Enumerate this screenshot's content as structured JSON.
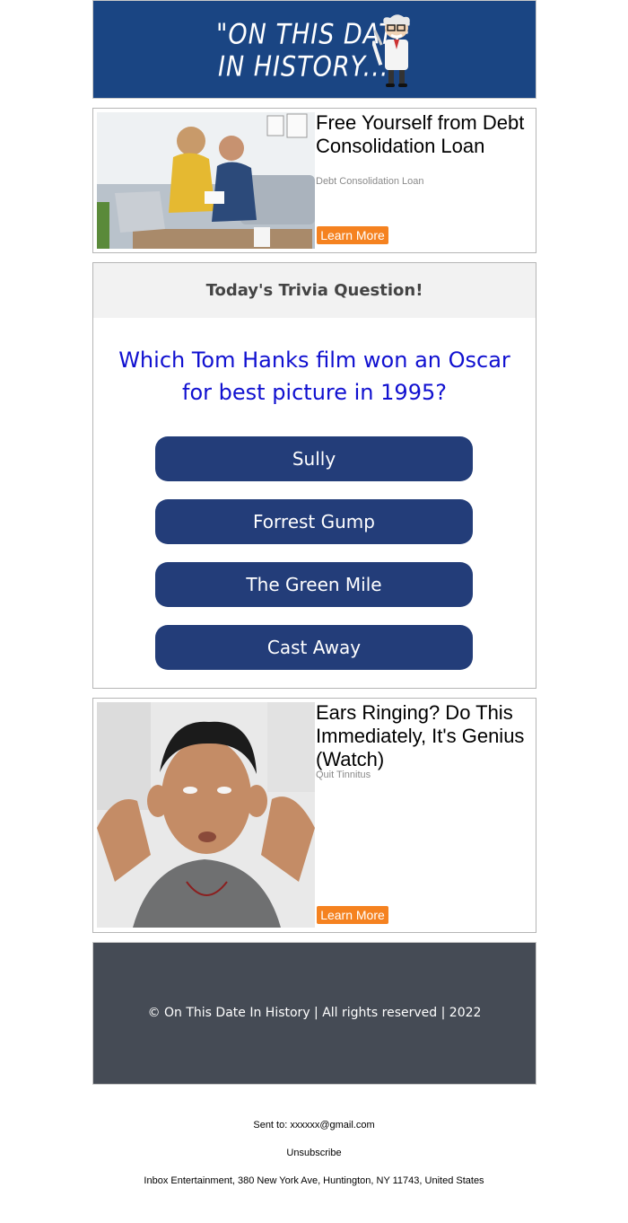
{
  "header": {
    "logo_line1": "\"ON THIS DATE",
    "logo_line2": "IN HISTORY...\""
  },
  "ads": [
    {
      "title": "Free Yourself from Debt Consolidation Loan",
      "source": "Debt Consolidation Loan",
      "cta": "Learn More",
      "image": "couple-reviewing-bills-photo"
    },
    {
      "title": "Ears Ringing? Do This Immediately, It's Genius (Watch)",
      "source": "Quit Tinnitus",
      "cta": "Learn More",
      "image": "man-plugging-ears-photo"
    }
  ],
  "trivia": {
    "heading": "Today's Trivia Question!",
    "question": "Which Tom Hanks film won an Oscar for best picture in 1995?",
    "answers": [
      "Sully",
      "Forrest Gump",
      "The Green Mile",
      "Cast Away"
    ]
  },
  "footer": {
    "copyright": "© On This Date In History | All rights reserved | 2022",
    "sent_to": "Sent to: xxxxxx@gmail.com",
    "unsubscribe": "Unsubscribe",
    "address": "Inbox Entertainment, 380 New York Ave, Huntington, NY 11743, United States"
  },
  "colors": {
    "header_bg": "#1a4583",
    "cta_orange": "#f58220",
    "answer_bg": "#233d79",
    "question_blue": "#1010d0",
    "footer_bg": "#454b55"
  }
}
